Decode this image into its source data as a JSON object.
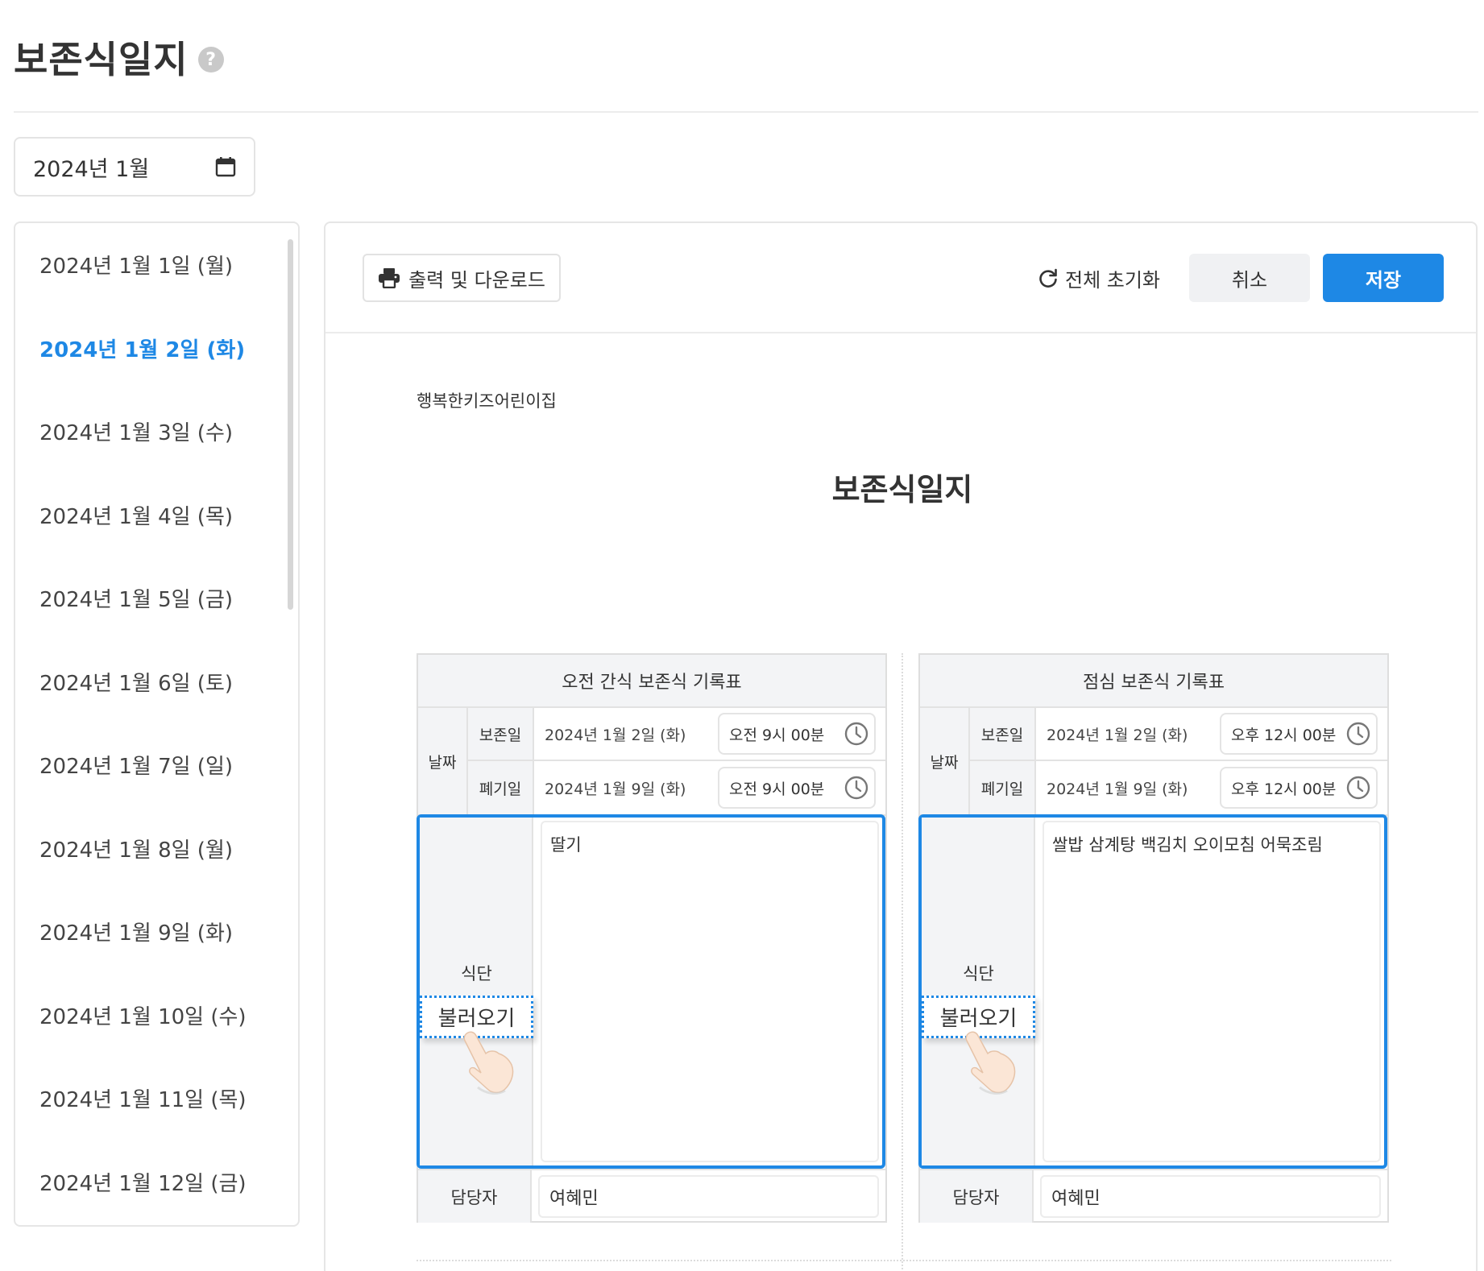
{
  "page": {
    "title": "보존식일지",
    "help": "?"
  },
  "month_picker": {
    "value": "2024년 1월"
  },
  "dates": [
    "2024년 1월 1일 (월)",
    "2024년 1월 2일 (화)",
    "2024년 1월 3일 (수)",
    "2024년 1월 4일 (목)",
    "2024년 1월 5일 (금)",
    "2024년 1월 6일 (토)",
    "2024년 1월 7일 (일)",
    "2024년 1월 8일 (월)",
    "2024년 1월 9일 (화)",
    "2024년 1월 10일 (수)",
    "2024년 1월 11일 (목)",
    "2024년 1월 12일 (금)"
  ],
  "selected_date_index": 1,
  "toolbar": {
    "print_label": "출력 및 다운로드",
    "reset_label": "전체 초기화",
    "cancel_label": "취소",
    "save_label": "저장"
  },
  "document": {
    "org_name": "행복한키즈어린이집",
    "title": "보존식일지",
    "records": [
      {
        "header": "오전 간식 보존식 기록표",
        "date_label": "날짜",
        "keep_label": "보존일",
        "keep_date": "2024년 1월 2일 (화)",
        "keep_time": "오전 9시 00분",
        "discard_label": "폐기일",
        "discard_date": "2024년 1월 9일 (화)",
        "discard_time": "오전 9시 00분",
        "menu_label": "식단",
        "load_label": "불러오기",
        "menu_text": "딸기",
        "manager_label": "담당자",
        "manager_name": "여혜민"
      },
      {
        "header": "점심 보존식 기록표",
        "date_label": "날짜",
        "keep_label": "보존일",
        "keep_date": "2024년 1월 2일 (화)",
        "keep_time": "오후 12시 00분",
        "discard_label": "폐기일",
        "discard_date": "2024년 1월 9일 (화)",
        "discard_time": "오후 12시 00분",
        "menu_label": "식단",
        "load_label": "불러오기",
        "menu_text": "쌀밥 삼계탕 백김치 오이모침 어묵조림",
        "manager_label": "담당자",
        "manager_name": "여혜민"
      }
    ]
  },
  "colors": {
    "accent": "#1e88e5",
    "panel_bg": "#f3f4f6",
    "border": "#e2e2e2"
  },
  "icons": [
    "help-icon",
    "calendar-icon",
    "printer-icon",
    "refresh-icon",
    "clock-icon",
    "pointing-hand-icon"
  ]
}
